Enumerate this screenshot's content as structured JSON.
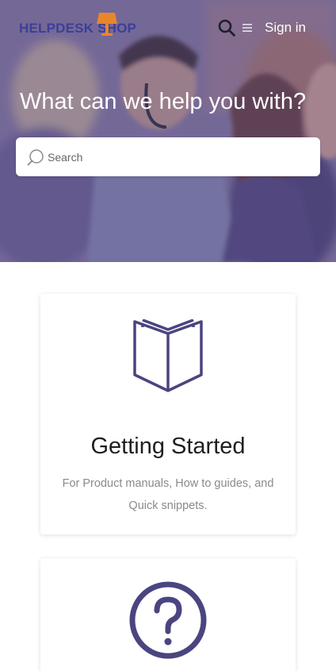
{
  "header": {
    "logo_text": "HELPDESK SHOP",
    "signin_label": "Sign in",
    "search_icon": "search-icon",
    "menu_icon": "hamburger-menu-icon"
  },
  "hero": {
    "title": "What can we help you with?",
    "search_placeholder": "Search"
  },
  "categories": [
    {
      "title": "Getting Started",
      "description": "For Product manuals, How to guides, and Quick snippets.",
      "icon": "open-book-icon"
    },
    {
      "title": "",
      "description": "",
      "icon": "question-circle-icon"
    }
  ],
  "colors": {
    "brand_purple": "#4a4580",
    "logo_blue": "#3a3f9a",
    "logo_lamp_orange": "#e8862b"
  }
}
